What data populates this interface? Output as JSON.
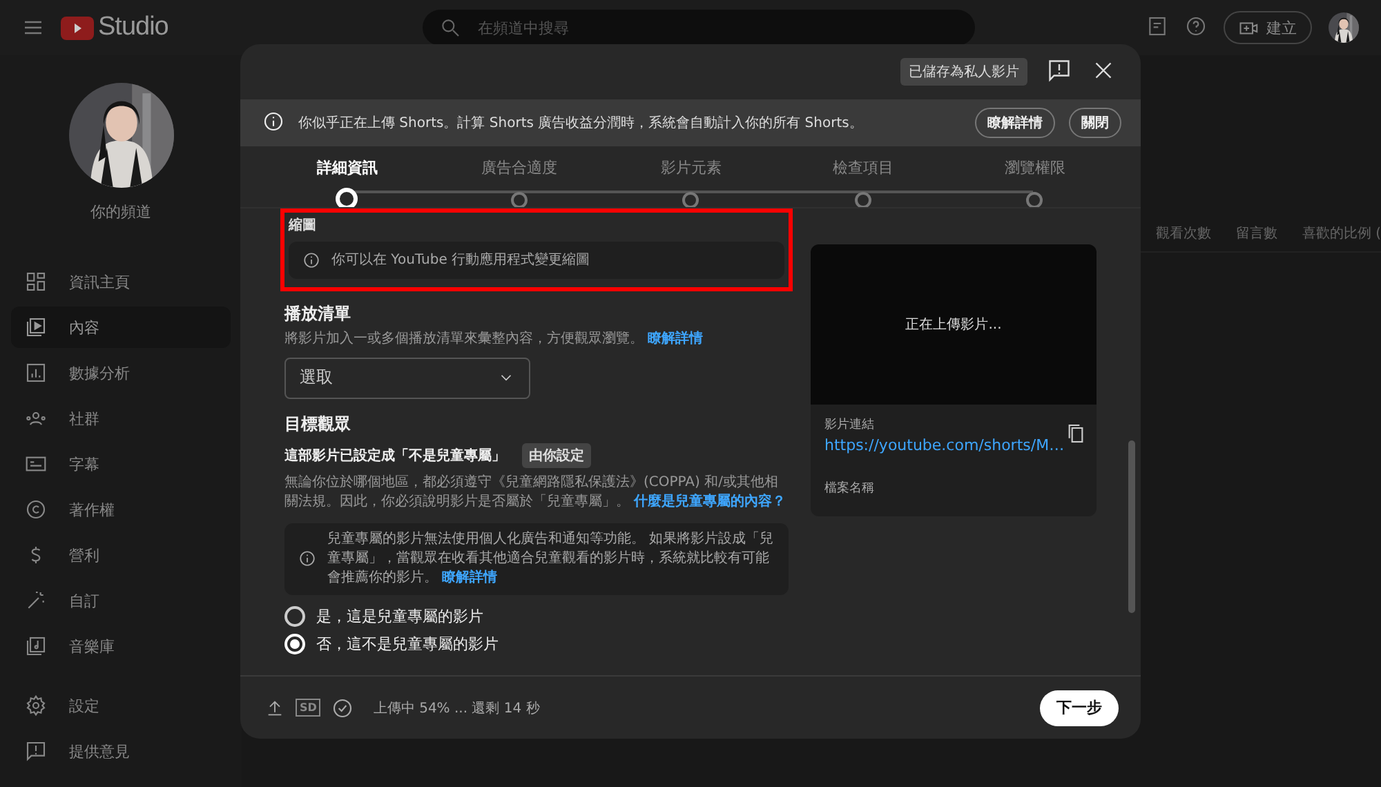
{
  "topbar": {
    "logo": "Studio",
    "search": {
      "placeholder": "在頻道中搜尋"
    },
    "create_button": "建立"
  },
  "sidebar": {
    "channel_label": "你的頻道",
    "items": [
      {
        "label": "資訊主頁",
        "selected": false
      },
      {
        "label": "內容",
        "selected": true
      },
      {
        "label": "數據分析",
        "selected": false
      },
      {
        "label": "社群",
        "selected": false
      },
      {
        "label": "字幕",
        "selected": false
      },
      {
        "label": "著作權",
        "selected": false
      },
      {
        "label": "營利",
        "selected": false
      },
      {
        "label": "自訂",
        "selected": false
      },
      {
        "label": "音樂庫",
        "selected": false
      }
    ],
    "bottom_items": [
      {
        "label": "設定"
      },
      {
        "label": "提供意見"
      }
    ]
  },
  "background_table": {
    "columns": [
      "觀看次數",
      "留言數",
      "喜歡的比例 ("
    ]
  },
  "dialog": {
    "saved_badge": "已儲存為私人影片",
    "banner": {
      "text": "你似乎正在上傳 Shorts。計算 Shorts 廣告收益分潤時，系統會自動計入你的所有 Shorts。",
      "buttons": [
        "瞭解詳情",
        "關閉"
      ]
    },
    "steps": [
      {
        "label": "詳細資訊",
        "selected": true
      },
      {
        "label": "廣告合適度",
        "selected": false
      },
      {
        "label": "影片元素",
        "selected": false
      },
      {
        "label": "檢查項目",
        "selected": false
      },
      {
        "label": "瀏覽權限",
        "selected": false
      }
    ],
    "thumbnail": {
      "title": "縮圖",
      "info": "你可以在 YouTube 行動應用程式變更縮圖",
      "highlighted": true
    },
    "playlist": {
      "title": "播放清單",
      "description": "將影片加入一或多個播放清單來彙整內容，方便觀眾瀏覽。",
      "link": "瞭解詳情",
      "dropdown": "選取"
    },
    "audience": {
      "title": "目標觀眾",
      "setting": "這部影片已設定成「不是兒童專屬」",
      "badge": "由你設定",
      "description": "無論你位於哪個地區，都必須遵守《兒童網路隱私保護法》(COPPA) 和/或其他相關法規。因此，你必須說明影片是否屬於「兒童專屬」。",
      "link": "什麼是兒童專屬的內容？",
      "info": "兒童專屬的影片無法使用個人化廣告和通知等功能。 如果將影片設成「兒童專屬」，當觀眾在收看其他適合兒童觀看的影片時，系統就比較有可能會推薦你的影片。",
      "info_link": "瞭解詳情",
      "options": [
        {
          "label": "是，這是兒童專屬的影片",
          "selected": false
        },
        {
          "label": "否，這不是兒童專屬的影片",
          "selected": true
        }
      ]
    },
    "preview": {
      "status": "正在上傳影片...",
      "link_label": "影片連結",
      "link": "https://youtube.com/shorts/M…",
      "filename_label": "檔案名稱"
    },
    "footer": {
      "sd_badge": "SD",
      "status": "上傳中 54% ... 還剩 14 秒",
      "next_button": "下一步"
    }
  }
}
